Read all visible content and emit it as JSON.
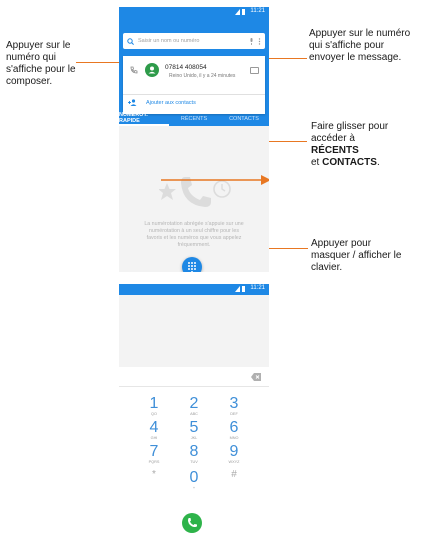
{
  "colors": {
    "accent": "#1e88e5",
    "leader": "#e87722",
    "call": "#2eb34a"
  },
  "top_phone": {
    "time": "11:21",
    "search_placeholder": "Saisir un nom ou numéro",
    "recent_call": {
      "number": "07814 408054",
      "detail": "Reino Unido, il y a 24 minutes"
    },
    "add_contact": "Ajouter aux contacts",
    "tabs": [
      "NUMÉROT. RAPIDE",
      "RÉCENTS",
      "CONTACTS"
    ],
    "empty_text": "La numérotation abrégée s'appuie sur une numérotation à un seul chiffre pour les favoris et les numéros que vous appelez fréquemment."
  },
  "bottom_phone": {
    "time": "11:21",
    "keys": [
      {
        "digit": "1",
        "letters": "QO"
      },
      {
        "digit": "2",
        "letters": "ABC"
      },
      {
        "digit": "3",
        "letters": "DEF"
      },
      {
        "digit": "4",
        "letters": "GHI"
      },
      {
        "digit": "5",
        "letters": "JKL"
      },
      {
        "digit": "6",
        "letters": "MNO"
      },
      {
        "digit": "7",
        "letters": "PQRS"
      },
      {
        "digit": "8",
        "letters": "TUV"
      },
      {
        "digit": "9",
        "letters": "WXYZ"
      },
      {
        "digit": "*",
        "letters": ""
      },
      {
        "digit": "0",
        "letters": "+"
      },
      {
        "digit": "#",
        "letters": ""
      }
    ]
  },
  "callouts": {
    "compose": "Appuyer sur le numéro qui s'affiche pour le composer.",
    "message": "Appuyer sur le numéro qui s'affiche pour envoyer le message.",
    "swipe_a": "Faire glisser pour accéder à",
    "swipe_recents": "RÉCENTS",
    "swipe_and": "et",
    "swipe_contacts": "CONTACTS",
    "swipe_end": ".",
    "keypad": "Appuyer pour masquer / afficher le clavier."
  }
}
